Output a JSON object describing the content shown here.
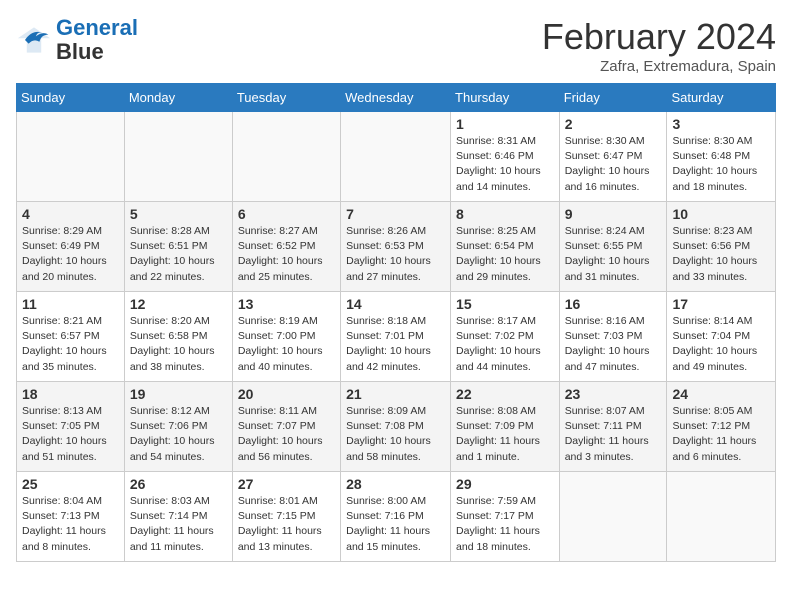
{
  "header": {
    "logo_general": "General",
    "logo_blue": "Blue",
    "title": "February 2024",
    "subtitle": "Zafra, Extremadura, Spain"
  },
  "weekdays": [
    "Sunday",
    "Monday",
    "Tuesday",
    "Wednesday",
    "Thursday",
    "Friday",
    "Saturday"
  ],
  "weeks": [
    [
      {
        "day": "",
        "empty": true
      },
      {
        "day": "",
        "empty": true
      },
      {
        "day": "",
        "empty": true
      },
      {
        "day": "",
        "empty": true
      },
      {
        "day": "1",
        "sunrise": "8:31 AM",
        "sunset": "6:46 PM",
        "daylight": "10 hours and 14 minutes."
      },
      {
        "day": "2",
        "sunrise": "8:30 AM",
        "sunset": "6:47 PM",
        "daylight": "10 hours and 16 minutes."
      },
      {
        "day": "3",
        "sunrise": "8:30 AM",
        "sunset": "6:48 PM",
        "daylight": "10 hours and 18 minutes."
      }
    ],
    [
      {
        "day": "4",
        "sunrise": "8:29 AM",
        "sunset": "6:49 PM",
        "daylight": "10 hours and 20 minutes."
      },
      {
        "day": "5",
        "sunrise": "8:28 AM",
        "sunset": "6:51 PM",
        "daylight": "10 hours and 22 minutes."
      },
      {
        "day": "6",
        "sunrise": "8:27 AM",
        "sunset": "6:52 PM",
        "daylight": "10 hours and 25 minutes."
      },
      {
        "day": "7",
        "sunrise": "8:26 AM",
        "sunset": "6:53 PM",
        "daylight": "10 hours and 27 minutes."
      },
      {
        "day": "8",
        "sunrise": "8:25 AM",
        "sunset": "6:54 PM",
        "daylight": "10 hours and 29 minutes."
      },
      {
        "day": "9",
        "sunrise": "8:24 AM",
        "sunset": "6:55 PM",
        "daylight": "10 hours and 31 minutes."
      },
      {
        "day": "10",
        "sunrise": "8:23 AM",
        "sunset": "6:56 PM",
        "daylight": "10 hours and 33 minutes."
      }
    ],
    [
      {
        "day": "11",
        "sunrise": "8:21 AM",
        "sunset": "6:57 PM",
        "daylight": "10 hours and 35 minutes."
      },
      {
        "day": "12",
        "sunrise": "8:20 AM",
        "sunset": "6:58 PM",
        "daylight": "10 hours and 38 minutes."
      },
      {
        "day": "13",
        "sunrise": "8:19 AM",
        "sunset": "7:00 PM",
        "daylight": "10 hours and 40 minutes."
      },
      {
        "day": "14",
        "sunrise": "8:18 AM",
        "sunset": "7:01 PM",
        "daylight": "10 hours and 42 minutes."
      },
      {
        "day": "15",
        "sunrise": "8:17 AM",
        "sunset": "7:02 PM",
        "daylight": "10 hours and 44 minutes."
      },
      {
        "day": "16",
        "sunrise": "8:16 AM",
        "sunset": "7:03 PM",
        "daylight": "10 hours and 47 minutes."
      },
      {
        "day": "17",
        "sunrise": "8:14 AM",
        "sunset": "7:04 PM",
        "daylight": "10 hours and 49 minutes."
      }
    ],
    [
      {
        "day": "18",
        "sunrise": "8:13 AM",
        "sunset": "7:05 PM",
        "daylight": "10 hours and 51 minutes."
      },
      {
        "day": "19",
        "sunrise": "8:12 AM",
        "sunset": "7:06 PM",
        "daylight": "10 hours and 54 minutes."
      },
      {
        "day": "20",
        "sunrise": "8:11 AM",
        "sunset": "7:07 PM",
        "daylight": "10 hours and 56 minutes."
      },
      {
        "day": "21",
        "sunrise": "8:09 AM",
        "sunset": "7:08 PM",
        "daylight": "10 hours and 58 minutes."
      },
      {
        "day": "22",
        "sunrise": "8:08 AM",
        "sunset": "7:09 PM",
        "daylight": "11 hours and 1 minute."
      },
      {
        "day": "23",
        "sunrise": "8:07 AM",
        "sunset": "7:11 PM",
        "daylight": "11 hours and 3 minutes."
      },
      {
        "day": "24",
        "sunrise": "8:05 AM",
        "sunset": "7:12 PM",
        "daylight": "11 hours and 6 minutes."
      }
    ],
    [
      {
        "day": "25",
        "sunrise": "8:04 AM",
        "sunset": "7:13 PM",
        "daylight": "11 hours and 8 minutes."
      },
      {
        "day": "26",
        "sunrise": "8:03 AM",
        "sunset": "7:14 PM",
        "daylight": "11 hours and 11 minutes."
      },
      {
        "day": "27",
        "sunrise": "8:01 AM",
        "sunset": "7:15 PM",
        "daylight": "11 hours and 13 minutes."
      },
      {
        "day": "28",
        "sunrise": "8:00 AM",
        "sunset": "7:16 PM",
        "daylight": "11 hours and 15 minutes."
      },
      {
        "day": "29",
        "sunrise": "7:59 AM",
        "sunset": "7:17 PM",
        "daylight": "11 hours and 18 minutes."
      },
      {
        "day": "",
        "empty": true
      },
      {
        "day": "",
        "empty": true
      }
    ]
  ]
}
